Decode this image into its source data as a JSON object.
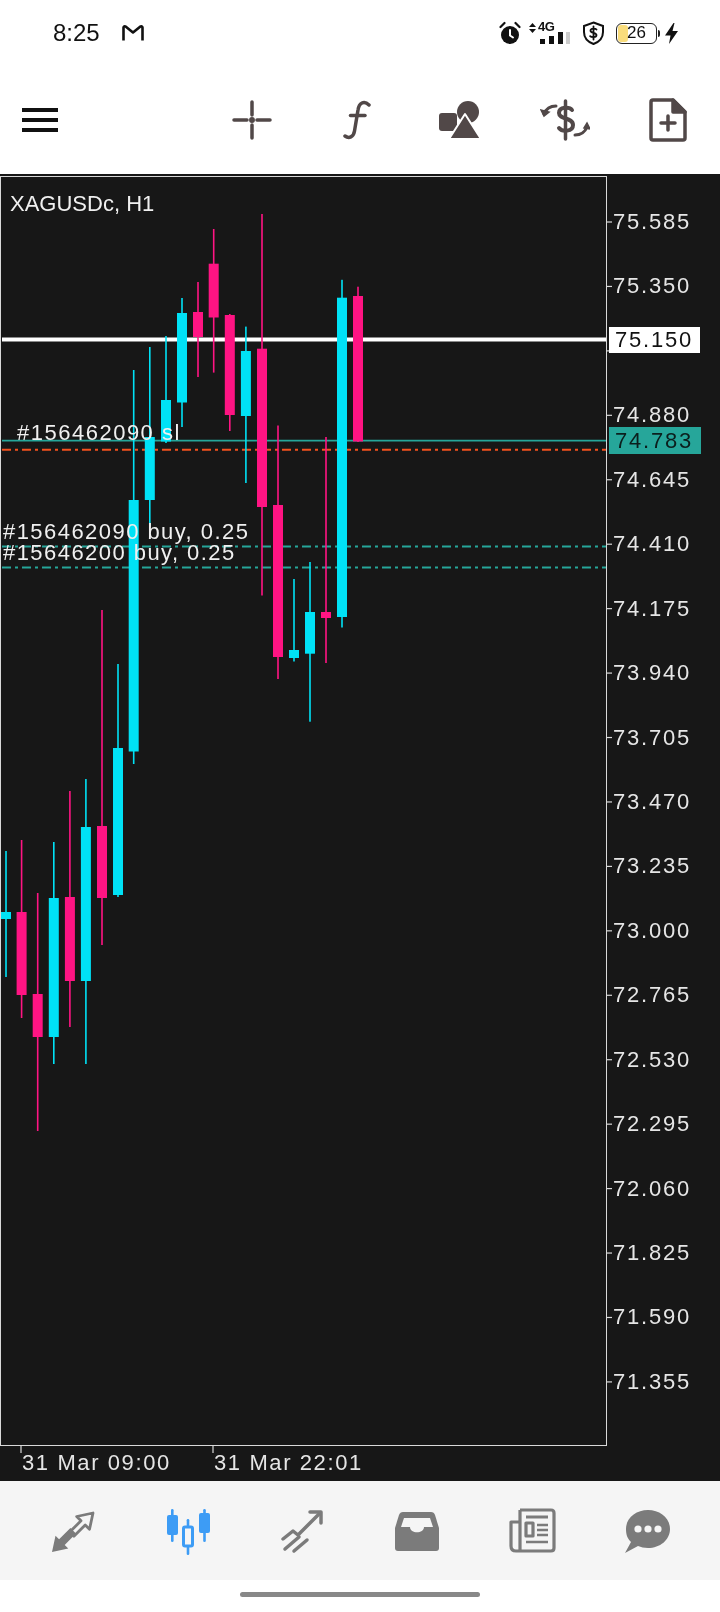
{
  "status_bar": {
    "time": "8:25",
    "network": "4G",
    "battery": "26"
  },
  "chart": {
    "title": "XAGUSDc, H1",
    "price_labels": [
      "75.585",
      "75.350",
      "74.880",
      "74.645",
      "74.410",
      "74.175",
      "73.940",
      "73.705",
      "73.470",
      "73.235",
      "73.000",
      "72.765",
      "72.530",
      "72.295",
      "72.060",
      "71.825",
      "71.590",
      "71.355"
    ],
    "time_labels": [
      "31 Mar 09:00",
      "31 Mar 22:01"
    ],
    "lines": [
      {
        "kind": "level",
        "tag": "75.150"
      },
      {
        "kind": "bid",
        "tag": "74.783"
      },
      {
        "kind": "stop_loss",
        "label": "#156462090 sl"
      },
      {
        "kind": "order",
        "label": "#156462090 buy, 0.25"
      },
      {
        "kind": "order",
        "label": "#15646200 buy, 0.25"
      }
    ]
  },
  "bottom_nav": [
    {
      "selected": false
    },
    {
      "selected": true
    },
    {
      "selected": false
    },
    {
      "selected": false
    },
    {
      "selected": false
    },
    {
      "selected": false
    }
  ]
}
